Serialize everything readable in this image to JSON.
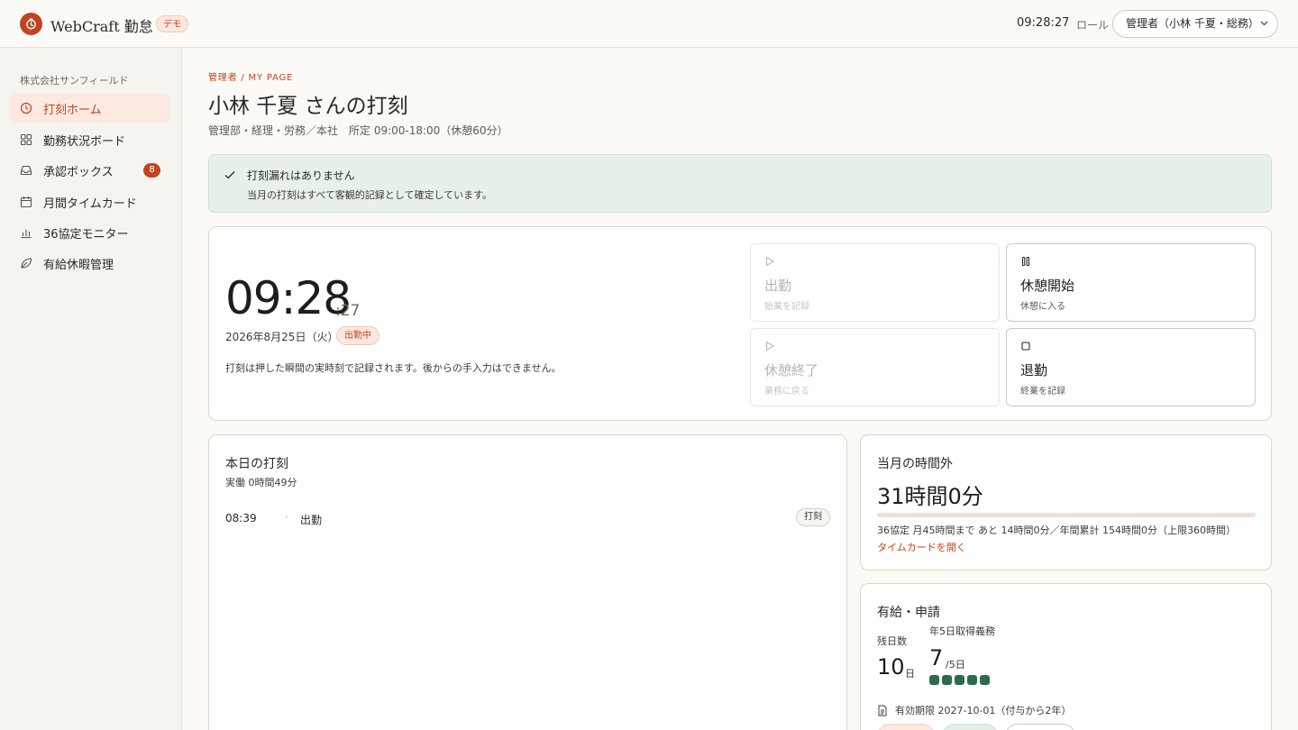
{
  "header": {
    "brand": "WebCraft 勤怠",
    "demo_badge": "デモ",
    "clock": "09:28:27",
    "role_label": "ロール",
    "role_value": "管理者（小林 千夏・総務）"
  },
  "sidebar": {
    "company": "株式会社サンフィールド",
    "items": [
      {
        "label": "打刻ホーム",
        "icon": "clock-icon",
        "active": true
      },
      {
        "label": "勤務状況ボード",
        "icon": "grid-icon"
      },
      {
        "label": "承認ボックス",
        "icon": "inbox-icon",
        "badge": "8"
      },
      {
        "label": "月間タイムカード",
        "icon": "calendar-icon"
      },
      {
        "label": "36協定モニター",
        "icon": "bar-chart-icon"
      },
      {
        "label": "有給休暇管理",
        "icon": "leaf-icon"
      }
    ]
  },
  "main": {
    "breadcrumb": "管理者 / MY PAGE",
    "title": "小林 千夏 さんの打刻",
    "subtitle": "管理部・経理・労務／本社　所定 09:00-18:00（休憩60分）",
    "alert": {
      "title": "打刻漏れはありません",
      "message": "当月の打刻はすべて客観的記録として確定しています。"
    },
    "punch": {
      "time_hm": "09:28",
      "time_s": ":27",
      "date": "2026年8月25日（火）",
      "status": "出勤中",
      "note": "打刻は押した瞬間の実時刻で記録されます。後からの手入力はできません。",
      "buttons": [
        {
          "label": "出勤",
          "sub": "始業を記録",
          "icon": "play-icon",
          "disabled": true
        },
        {
          "label": "休憩開始",
          "sub": "休憩に入る",
          "icon": "pause-icon",
          "disabled": false
        },
        {
          "label": "休憩終了",
          "sub": "業務に戻る",
          "icon": "play-icon",
          "disabled": true
        },
        {
          "label": "退勤",
          "sub": "終業を記録",
          "icon": "stop-icon",
          "disabled": false
        }
      ]
    },
    "today": {
      "title": "本日の打刻",
      "worked": "実働 0時間49分",
      "records": [
        {
          "time": "08:39",
          "sep": "·",
          "type": "出勤",
          "tag": "打刻"
        }
      ]
    },
    "overtime": {
      "title": "当月の時間外",
      "value": "31時間0分",
      "progress_percent": 0,
      "note": "36協定 月45時間まで あと 14時間0分／年間累計 154時間0分（上限360時間）",
      "link": "タイムカードを開く"
    },
    "leave": {
      "title": "有給・申請",
      "remain_label": "残日数",
      "remain_value": "10",
      "remain_unit": "日",
      "obligation_label": "年5日取得義務",
      "obligation_value": "7",
      "obligation_unit": "/5日",
      "obligation_done": 5,
      "expiry": "有効期限 2027-10-01（付与から2年）"
    }
  },
  "colors": {
    "accent": "#c0451e",
    "success_bg": "#e7f1ea",
    "leave_dot": "#2f6b4a"
  }
}
